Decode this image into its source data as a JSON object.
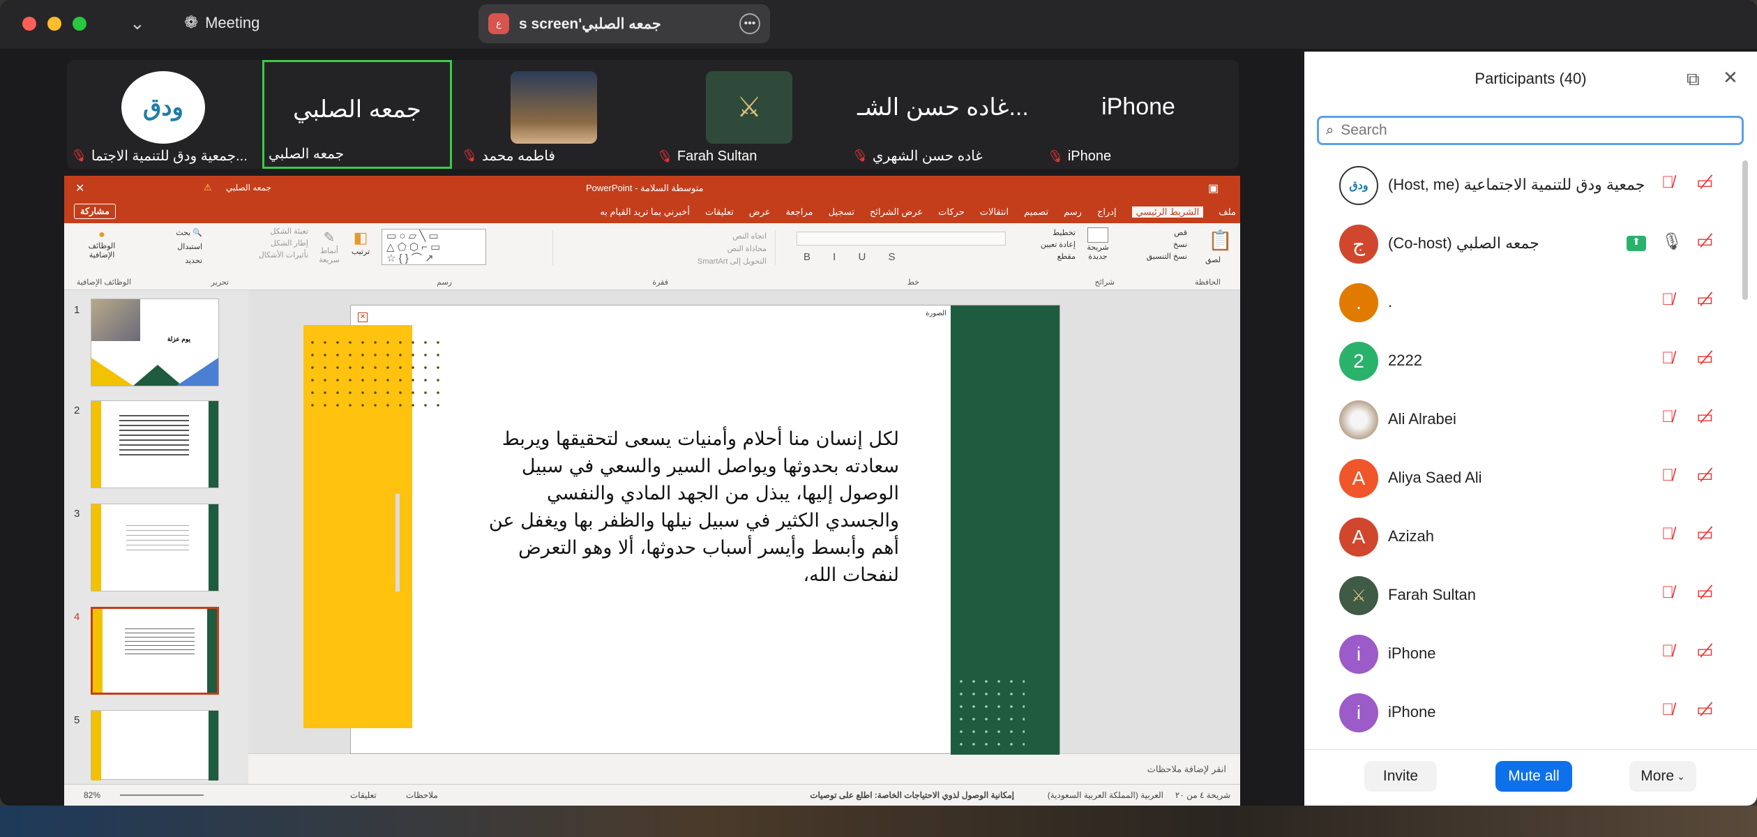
{
  "titlebar": {
    "meeting_label": "Meeting",
    "share_title": "s screen'جمعه الصلبي",
    "share_badge": "ع"
  },
  "colors": {
    "accent": "#0e71eb",
    "ppt_brand": "#c43e1c",
    "mute_red": "#e33b3b",
    "active_speaker": "#3ccb4a"
  },
  "strip": {
    "tiles": [
      {
        "name": "جمعية ودق للتنمية الاجتما...",
        "logo_text": "ودق",
        "muted": true
      },
      {
        "name": "جمعه الصلبي",
        "big": "جمعه الصلبي",
        "muted": false,
        "active": true
      },
      {
        "name": "فاطمه محمد",
        "muted": true
      },
      {
        "name": "Farah Sultan",
        "muted": true
      },
      {
        "name": "غاده حسن الشهري",
        "big": "غاده حسن الشـ...",
        "muted": true
      },
      {
        "name": "iPhone",
        "big": "iPhone",
        "muted": true
      }
    ]
  },
  "ppt": {
    "title": "PowerPoint - متوسطة السلامة",
    "user": "جمعه الصلبي",
    "tabs": [
      "ملف",
      "الشريط الرئيسي",
      "إدراج",
      "رسم",
      "تصميم",
      "انتقالات",
      "حركات",
      "عرض الشرائح",
      "تسجيل",
      "مراجعة",
      "عرض",
      "تعليقات",
      "أخبرني بما تريد القيام به"
    ],
    "share_button": "مشاركة",
    "ribbon_groups": [
      "الحافظة",
      "شرائح",
      "خط",
      "فقرة",
      "رسم",
      "تحرير",
      "الوظائف الإضافية"
    ],
    "ribbon_items": {
      "paste": "لصق",
      "cut": "قص",
      "copy": "نسخ",
      "format": "نسخ التنسيق",
      "new_slide": "شريحة جديدة",
      "layout": "تخطيط",
      "reset": "إعادة تعيين",
      "section": "مقطع",
      "find": "بحث",
      "replace": "استبدال",
      "select": "تحديد",
      "addins": "الوظائف الإضافية",
      "arrange": "ترتيب",
      "styles": "أنماط سريعة",
      "shape_fill": "تعبئة الشكل",
      "shape_outline": "إطار الشكل",
      "shape_effects": "تأثيرات الأشكال",
      "text_dir": "اتجاه النص",
      "align_text": "محاذاة النص",
      "smartart": "التحويل إلى SmartArt"
    },
    "slide_numbers": [
      "1",
      "2",
      "3",
      "4",
      "5"
    ],
    "thumb1_title": "يوم عزلة",
    "slide_label": "الصورة",
    "slide_text": "لكل إنسان منا أحلام وأمنيات يسعى لتحقيقها ويربط سعادته بحدوثها ويواصل السير والسعي في سبيل الوصول إليها، يبذل من الجهد المادي والنفسي والجسدي الكثير في سبيل نيلها والظفر بها ويغفل عن أهم وأبسط وأيسر أسباب حدوثها، ألا وهو التعرض لنفحات الله،",
    "notes_placeholder": "انقر لإضافة ملاحظات",
    "status": {
      "slide": "شريحة ٤ من ٢٠",
      "lang": "العربية (المملكة العربية السعودية)",
      "access": "إمكانية الوصول لذوي الاحتياجات الخاصة: اطلع على توصيات",
      "notes": "ملاحظات",
      "comments": "تعليقات",
      "zoom": "82%"
    }
  },
  "panel": {
    "title": "Participants (40)",
    "search_placeholder": "Search",
    "participants": [
      {
        "name": "جمعية ودق للتنمية الاجتماعية (Host, me)",
        "initial": "ودق",
        "color": "#ffffff",
        "logo": true,
        "sharing": false
      },
      {
        "name": "جمعه الصلبي (Co-host)",
        "initial": "ج",
        "color": "#d0472e",
        "sharing": true
      },
      {
        "name": ".",
        "initial": ".",
        "color": "#e07b00",
        "sharing": false
      },
      {
        "name": "2222",
        "initial": "2",
        "color": "#2ab26b",
        "sharing": false
      },
      {
        "name": "Ali Alrabei",
        "initial": "",
        "color": "#b9a58d",
        "photo": true,
        "sharing": false
      },
      {
        "name": "Aliya Saed Ali",
        "initial": "A",
        "color": "#f0562a",
        "sharing": false
      },
      {
        "name": "Azizah",
        "initial": "A",
        "color": "#d0472e",
        "sharing": false
      },
      {
        "name": "Farah Sultan",
        "initial": "",
        "color": "#3f5a45",
        "photo": true,
        "sharing": false
      },
      {
        "name": "iPhone",
        "initial": "i",
        "color": "#9b5bc9",
        "sharing": false
      },
      {
        "name": "iPhone",
        "initial": "i",
        "color": "#9b5bc9",
        "sharing": false
      }
    ],
    "invite": "Invite",
    "mute_all": "Mute all",
    "more": "More"
  }
}
